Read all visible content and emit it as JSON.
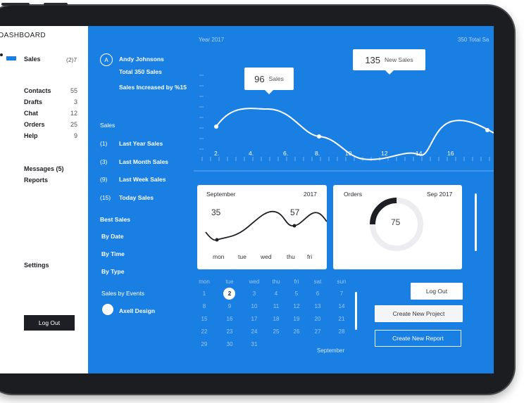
{
  "sidebar": {
    "title": "DASHBOARD",
    "active_label": "Sales",
    "active_count": "(2)7",
    "items": [
      {
        "label": "Contacts",
        "count": "55"
      },
      {
        "label": "Drafts",
        "count": "3"
      },
      {
        "label": "Chat",
        "count": "12"
      },
      {
        "label": "Orders",
        "count": "25"
      },
      {
        "label": "Help",
        "count": "9"
      }
    ],
    "messages": "Messages (5)",
    "reports": "Reports",
    "settings": "Settings",
    "logout": "Log Out"
  },
  "profile": {
    "avatar_letter": "A",
    "name": "Andy Johnsons",
    "total": "Total 350 Sales",
    "increase": "Sales Increased by %15"
  },
  "sales": {
    "heading": "Sales",
    "items": [
      {
        "count": "(1)",
        "label": "Last Year Sales"
      },
      {
        "count": "(3)",
        "label": "Last Month Sales"
      },
      {
        "count": "(9)",
        "label": "Last Week Sales"
      },
      {
        "count": "(15)",
        "label": "Today Sales"
      }
    ]
  },
  "best_sales": {
    "heading": "Best Sales",
    "items": [
      "By Date",
      "By Time",
      "By Type"
    ]
  },
  "events": {
    "heading": "Sales by Events",
    "item": "Axell Design"
  },
  "main_chart": {
    "year_label": "Year 2017",
    "total_label": "350 Total Sa",
    "x_labels": [
      "2.",
      "4.",
      "6.",
      "8.",
      "10.",
      "12",
      "14",
      "16"
    ],
    "tooltip_a": {
      "value": "96",
      "label": "Sales"
    },
    "tooltip_b": {
      "value": "135",
      "label": "New Sales"
    }
  },
  "september_card": {
    "title": "September",
    "year": "2017",
    "value_a": "35",
    "value_b": "57",
    "days": [
      "mon",
      "tue",
      "wed",
      "thu",
      "fri"
    ]
  },
  "orders_card": {
    "title": "Orders",
    "date": "Sep 2017",
    "value": "75",
    "progress": 0.25
  },
  "calendar": {
    "days": [
      "mon",
      "tue",
      "wed",
      "thu",
      "fri",
      "sat",
      "sun"
    ],
    "rows": [
      [
        "1",
        "2",
        "3",
        "4",
        "5",
        "6",
        "7"
      ],
      [
        "8",
        "9",
        "10",
        "11",
        "12",
        "13",
        "14"
      ],
      [
        "15",
        "16",
        "17",
        "18",
        "19",
        "20",
        "21"
      ],
      [
        "22",
        "23",
        "24",
        "25",
        "26",
        "27",
        "28"
      ],
      [
        "29",
        "30",
        "31",
        "",
        "",
        "",
        ""
      ]
    ],
    "selected": "2",
    "month": "September"
  },
  "buttons": {
    "logout": "Log Out",
    "create_project": "Create New Project",
    "create_report": "Create New Report"
  },
  "colors": {
    "accent": "#1a7fe3",
    "dark": "#1d1f24"
  }
}
